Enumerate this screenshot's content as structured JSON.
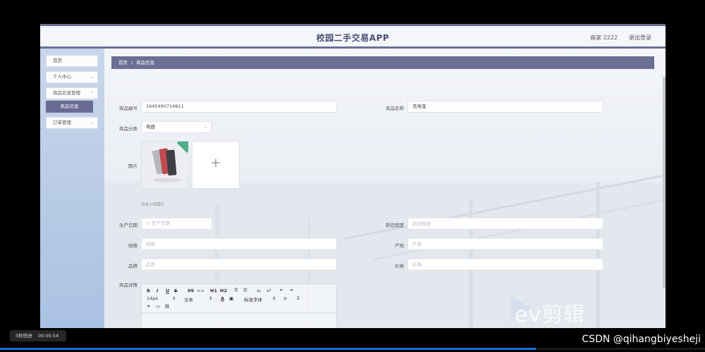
{
  "header": {
    "app_title": "校园二手交易APP",
    "user_label": "商家 2222",
    "logout_label": "退出登录"
  },
  "sidebar": {
    "items": [
      {
        "label": "首页"
      },
      {
        "label": "个人中心"
      },
      {
        "label": "商品信息管理"
      },
      {
        "label": "订单管理"
      }
    ],
    "active_sub": {
      "label": "商品信息"
    }
  },
  "breadcrumb": {
    "home": "首页",
    "separator": "/",
    "current": "商品信息"
  },
  "form": {
    "code": {
      "label": "商品编号",
      "value": "1645490714811"
    },
    "name": {
      "label": "商品名称",
      "value": "充电宝"
    },
    "category": {
      "label": "商品分类",
      "value": "电器"
    },
    "image": {
      "label": "图片",
      "hint": "点击上传图片",
      "upload_glyph": "+"
    },
    "production_date": {
      "label": "生产日期",
      "placeholder": "生产日期"
    },
    "condition": {
      "label": "新旧程度",
      "placeholder": "新旧程度"
    },
    "spec": {
      "label": "规格",
      "placeholder": "规格"
    },
    "origin": {
      "label": "产地",
      "placeholder": "产地"
    },
    "brand": {
      "label": "品牌",
      "placeholder": "品牌"
    },
    "price": {
      "label": "价格",
      "placeholder": "价格"
    },
    "detail": {
      "label": "商品详情"
    }
  },
  "editor_toolbar": {
    "bold": "B",
    "italic": "I",
    "underline": "U",
    "strike": "S",
    "quote": "99",
    "code": "<>",
    "h1": "H1",
    "h2": "H2",
    "sub": "x₂",
    "sup": "x²",
    "font_size": "14px",
    "text_type": "文本",
    "font_family": "标准字体"
  },
  "overlay": {
    "watermark": "ev剪辑",
    "speed": "5秒快进",
    "time": "00:05:54",
    "source": "CSDN @qihangbiyesheji",
    "progress": 0.76
  },
  "colors": {
    "accent": "#6b6f96",
    "active_menu": "#686b94",
    "sidebar": "#b7c8e6"
  }
}
